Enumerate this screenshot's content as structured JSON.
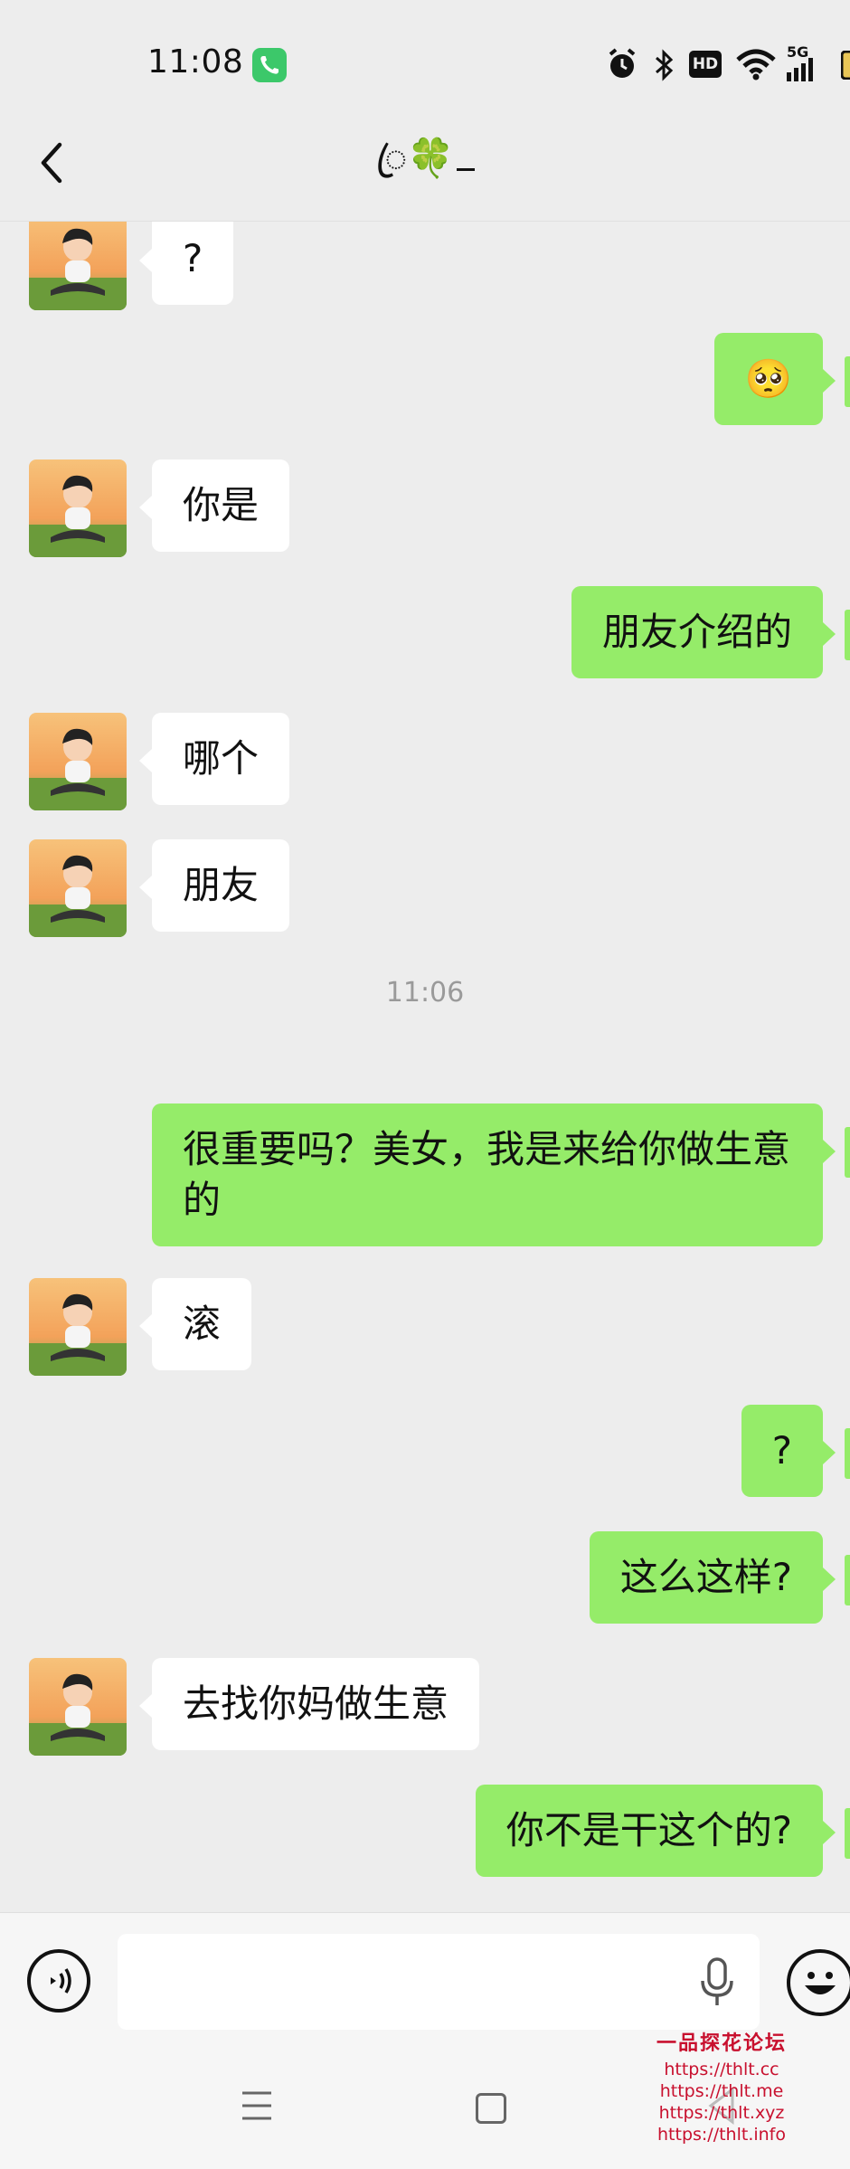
{
  "status_bar": {
    "time": "11:08",
    "network": "5G",
    "hd": "HD",
    "icons": [
      "phone-call-icon",
      "alarm-icon",
      "bluetooth-icon",
      "hd-icon",
      "wifi-icon",
      "signal-icon",
      "battery-icon"
    ]
  },
  "header": {
    "title_prefix": "ꦿ",
    "title_emoji": "🍀",
    "back_icon": "chevron-left-icon"
  },
  "messages": [
    {
      "side": "in",
      "text": "?"
    },
    {
      "side": "out",
      "text": "🥺"
    },
    {
      "side": "in",
      "text": "你是"
    },
    {
      "side": "out",
      "text": "朋友介绍的"
    },
    {
      "side": "in",
      "text": "哪个"
    },
    {
      "side": "in",
      "text": "朋友"
    },
    {
      "side": "time",
      "text": "11:06"
    },
    {
      "side": "out",
      "text": "很重要吗？美女，我是来给你做生意的"
    },
    {
      "side": "in",
      "text": "滚"
    },
    {
      "side": "out",
      "text": "?"
    },
    {
      "side": "out",
      "text": "这么这样?"
    },
    {
      "side": "in",
      "text": "去找你妈做生意"
    },
    {
      "side": "out",
      "text": "你不是干这个的?"
    }
  ],
  "input": {
    "placeholder": "",
    "value": "",
    "voice_icon": "voice-icon",
    "mic_icon": "mic-icon",
    "emoji_icon": "emoji-icon"
  },
  "watermark": {
    "title": "一品探花论坛",
    "urls": [
      "https://thlt.cc",
      "https://thlt.me",
      "https://thlt.xyz",
      "https://thlt.info"
    ]
  },
  "colors": {
    "background": "#ededed",
    "outgoing_bubble": "#95ec69",
    "incoming_bubble": "#ffffff",
    "watermark": "#c8102e"
  }
}
